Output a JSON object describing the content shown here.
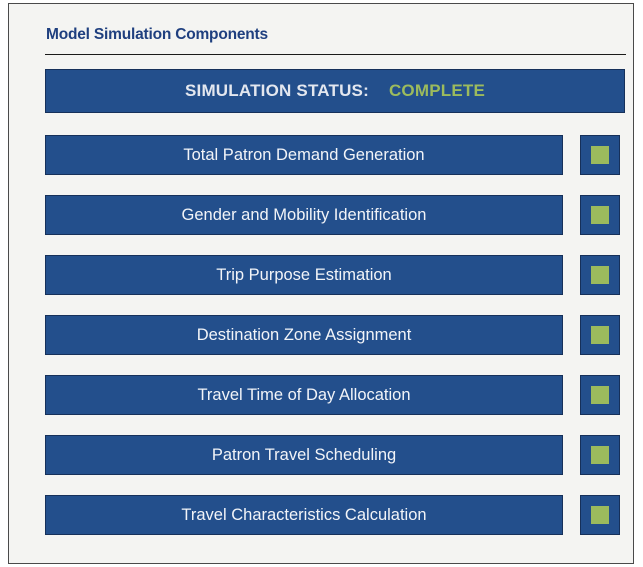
{
  "panel": {
    "title": "Model Simulation Components"
  },
  "status": {
    "label": "SIMULATION STATUS:",
    "value": "COMPLETE"
  },
  "colors": {
    "bar_fill": "#234f8c",
    "bar_border": "#16305a",
    "complete_accent": "#9cbb5d",
    "title_text": "#1f3f7f"
  },
  "steps": [
    {
      "label": "Total Patron Demand Generation",
      "complete": true,
      "indicator_icon": "complete-square-icon"
    },
    {
      "label": "Gender and Mobility Identification",
      "complete": true,
      "indicator_icon": "complete-square-icon"
    },
    {
      "label": "Trip Purpose Estimation",
      "complete": true,
      "indicator_icon": "complete-square-icon"
    },
    {
      "label": "Destination Zone Assignment",
      "complete": true,
      "indicator_icon": "complete-square-icon"
    },
    {
      "label": "Travel Time of Day Allocation",
      "complete": true,
      "indicator_icon": "complete-square-icon"
    },
    {
      "label": "Patron Travel Scheduling",
      "complete": true,
      "indicator_icon": "complete-square-icon"
    },
    {
      "label": "Travel Characteristics Calculation",
      "complete": true,
      "indicator_icon": "complete-square-icon"
    }
  ]
}
